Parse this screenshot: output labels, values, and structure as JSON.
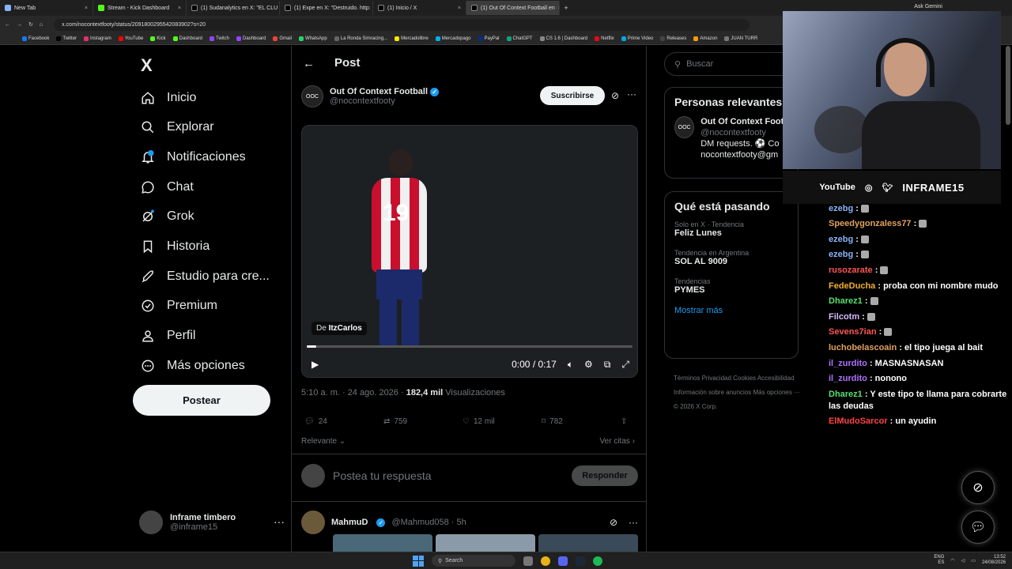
{
  "browser": {
    "tabs": [
      {
        "label": "New Tab",
        "color": "#8ab4f8"
      },
      {
        "label": "Stream - Kick Dashboard",
        "color": "#53fc18"
      },
      {
        "label": "(1) Sudanalytics en X: \"EL CLU",
        "color": "#000000"
      },
      {
        "label": "(1) Expe en X: \"Destruido. http:",
        "color": "#000000"
      },
      {
        "label": "(1) Inicio / X",
        "color": "#000000"
      },
      {
        "label": "(1) Out Of Context Football en",
        "color": "#000000"
      }
    ],
    "ask_gemini": "Ask Gemini",
    "url": "x.com/nocontextfooty/status/2091800295542083902?s=20",
    "bookmarks": [
      {
        "label": "Facebook",
        "color": "#1877f2"
      },
      {
        "label": "Twitter",
        "color": "#000000"
      },
      {
        "label": "Instagram",
        "color": "#e1306c"
      },
      {
        "label": "YouTube",
        "color": "#ff0000"
      },
      {
        "label": "Kick",
        "color": "#53fc18"
      },
      {
        "label": "Dashboard",
        "color": "#53fc18"
      },
      {
        "label": "Twitch",
        "color": "#9146ff"
      },
      {
        "label": "Dashboard",
        "color": "#9146ff"
      },
      {
        "label": "Gmail",
        "color": "#ea4335"
      },
      {
        "label": "WhatsApp",
        "color": "#25d366"
      },
      {
        "label": "La Ronda Simracing...",
        "color": "#666666"
      },
      {
        "label": "Mercadolibre",
        "color": "#ffe600"
      },
      {
        "label": "Mercadopago",
        "color": "#00b1ea"
      },
      {
        "label": "PayPal",
        "color": "#003087"
      },
      {
        "label": "ChatGPT",
        "color": "#10a37f"
      },
      {
        "label": "CS 1.6 | Dashboard",
        "color": "#888888"
      },
      {
        "label": "Netflix",
        "color": "#e50914"
      },
      {
        "label": "Prime Video",
        "color": "#00a8e1"
      },
      {
        "label": "Releases",
        "color": "#444444"
      },
      {
        "label": "Amazon",
        "color": "#ff9900"
      },
      {
        "label": "JUAN TURR",
        "color": "#777777"
      }
    ]
  },
  "nav": {
    "logo": "X",
    "items": [
      "Inicio",
      "Explorar",
      "Notificaciones",
      "Chat",
      "Grok",
      "Historia",
      "Estudio para cre...",
      "Premium",
      "Perfil",
      "Más opciones"
    ],
    "notif_badge": "1",
    "post_button": "Postear",
    "user_name": "Inframe timbero",
    "user_handle": "@inframe15"
  },
  "post": {
    "header": "Post",
    "author_name": "Out Of Context Football",
    "author_handle": "@nocontextfooty",
    "avatar_text": "OOC",
    "subscribe": "Suscribirse",
    "video": {
      "via_prefix": "De",
      "via_user": "ItzCarlos",
      "jersey_number": "19",
      "time": "0:00 / 0:17",
      "progress_fraction": 0.03
    },
    "meta_time": "5:10 a. m. · 24 ago. 2026 · ",
    "views": "182,4 mil",
    "views_label": " Visualizaciones",
    "replies": "24",
    "reposts": "759",
    "likes": "12 mil",
    "bookmarks": "782",
    "sort": "Relevante",
    "quotes": "Ver citas",
    "reply_placeholder": "Postea tu respuesta",
    "reply_button": "Responder",
    "reply_user": "MahmuD",
    "reply_handle": "@Mahmud058 · 5h"
  },
  "sidebar": {
    "search_placeholder": "Buscar",
    "relevant_title": "Personas relevantes",
    "relevant_name": "Out Of Context Football",
    "relevant_handle": "@nocontextfooty",
    "relevant_bio": "DM requests. ⚽ Co",
    "relevant_bio2": "nocontextfooty@gm",
    "trends_title": "Qué está pasando",
    "trends": [
      {
        "category": "Solo en X · Tendencia",
        "title": "Feliz Lunes"
      },
      {
        "category": "Tendencia en Argentina",
        "title": "SOL AL 9009"
      },
      {
        "category": "Tendencias",
        "title": "PYMES"
      }
    ],
    "show_more": "Mostrar más",
    "footer_line1": "Términos   Privacidad   Cookies   Accesibilidad",
    "footer_line2": "Información sobre anuncios   Más opciones ···",
    "footer_line3": "© 2026 X Corp."
  },
  "stream_overlay": {
    "socials_youtube": "YouTube",
    "socials_brand": "INFRAME15",
    "chat": [
      {
        "user": "ezebg",
        "color": "#8ab4f8",
        "text": ""
      },
      {
        "user": "Speedygonzaless77",
        "color": "#e0a060",
        "text": ""
      },
      {
        "user": "ezebg",
        "color": "#8ab4f8",
        "text": ""
      },
      {
        "user": "ezebg",
        "color": "#8ab4f8",
        "text": ""
      },
      {
        "user": "rusozarate",
        "color": "#ff5555",
        "text": ""
      },
      {
        "user": "FedeDucha",
        "color": "#f0b030",
        "text": "proba con mi nombre mudo"
      },
      {
        "user": "Dharez1",
        "color": "#55e070",
        "text": ""
      },
      {
        "user": "Filcotm",
        "color": "#d8b8ff",
        "text": ""
      },
      {
        "user": "Sevens7ian",
        "color": "#ff5555",
        "text": ""
      },
      {
        "user": "luchobelascoain",
        "color": "#e0a060",
        "text": "el tipo juega al bait"
      },
      {
        "user": "il_zurdito",
        "color": "#b070ff",
        "text": "MASNASNASAN"
      },
      {
        "user": "il_zurdito",
        "color": "#b070ff",
        "text": "nonono"
      },
      {
        "user": "Dharez1",
        "color": "#55e070",
        "text": "Y este tipo te llama para cobrarte las deudas"
      },
      {
        "user": "ElMudoSarcor",
        "color": "#ff4444",
        "text": "un ayudin"
      }
    ]
  },
  "taskbar": {
    "search": "Search",
    "lang1": "ENG",
    "lang2": "ES",
    "time": "13:52",
    "date": "24/08/2026"
  }
}
